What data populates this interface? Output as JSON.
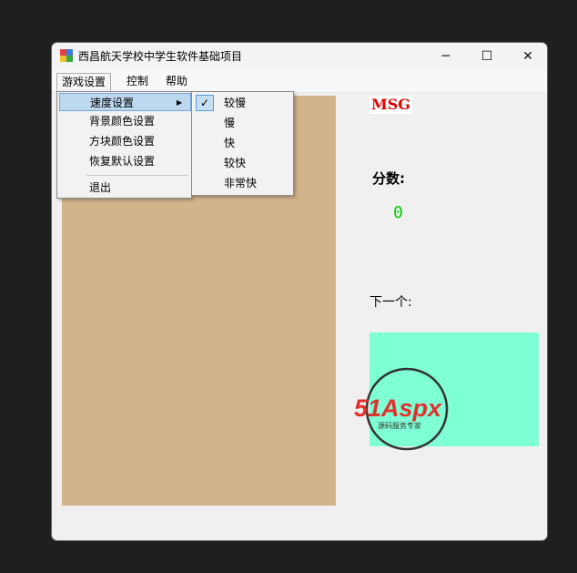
{
  "window": {
    "title": "西昌航天学校中学生软件基础项目",
    "minimize_glyph": "─",
    "maximize_glyph": "☐",
    "close_glyph": "✕"
  },
  "menubar": {
    "items": [
      "游戏设置",
      "控制",
      "帮助"
    ]
  },
  "game_menu": {
    "items": [
      "速度设置",
      "背景颜色设置",
      "方块颜色设置",
      "恢复默认设置",
      "退出"
    ],
    "submenu_arrow": "▶"
  },
  "speed_menu": {
    "items": [
      "较慢",
      "慢",
      "快",
      "较快",
      "非常快"
    ],
    "checked_index": 0,
    "check_glyph": "✓"
  },
  "panel": {
    "msg": "MSG",
    "score_label": "分数:",
    "score_value": "0",
    "next_label": "下一个:"
  },
  "watermark": {
    "brand": "51Aspx",
    "tagline": "源码服务专家"
  },
  "colors": {
    "board": "#d2b48c",
    "next_box": "#7fffd4",
    "msg": "#e00000",
    "score": "#00cc00"
  }
}
